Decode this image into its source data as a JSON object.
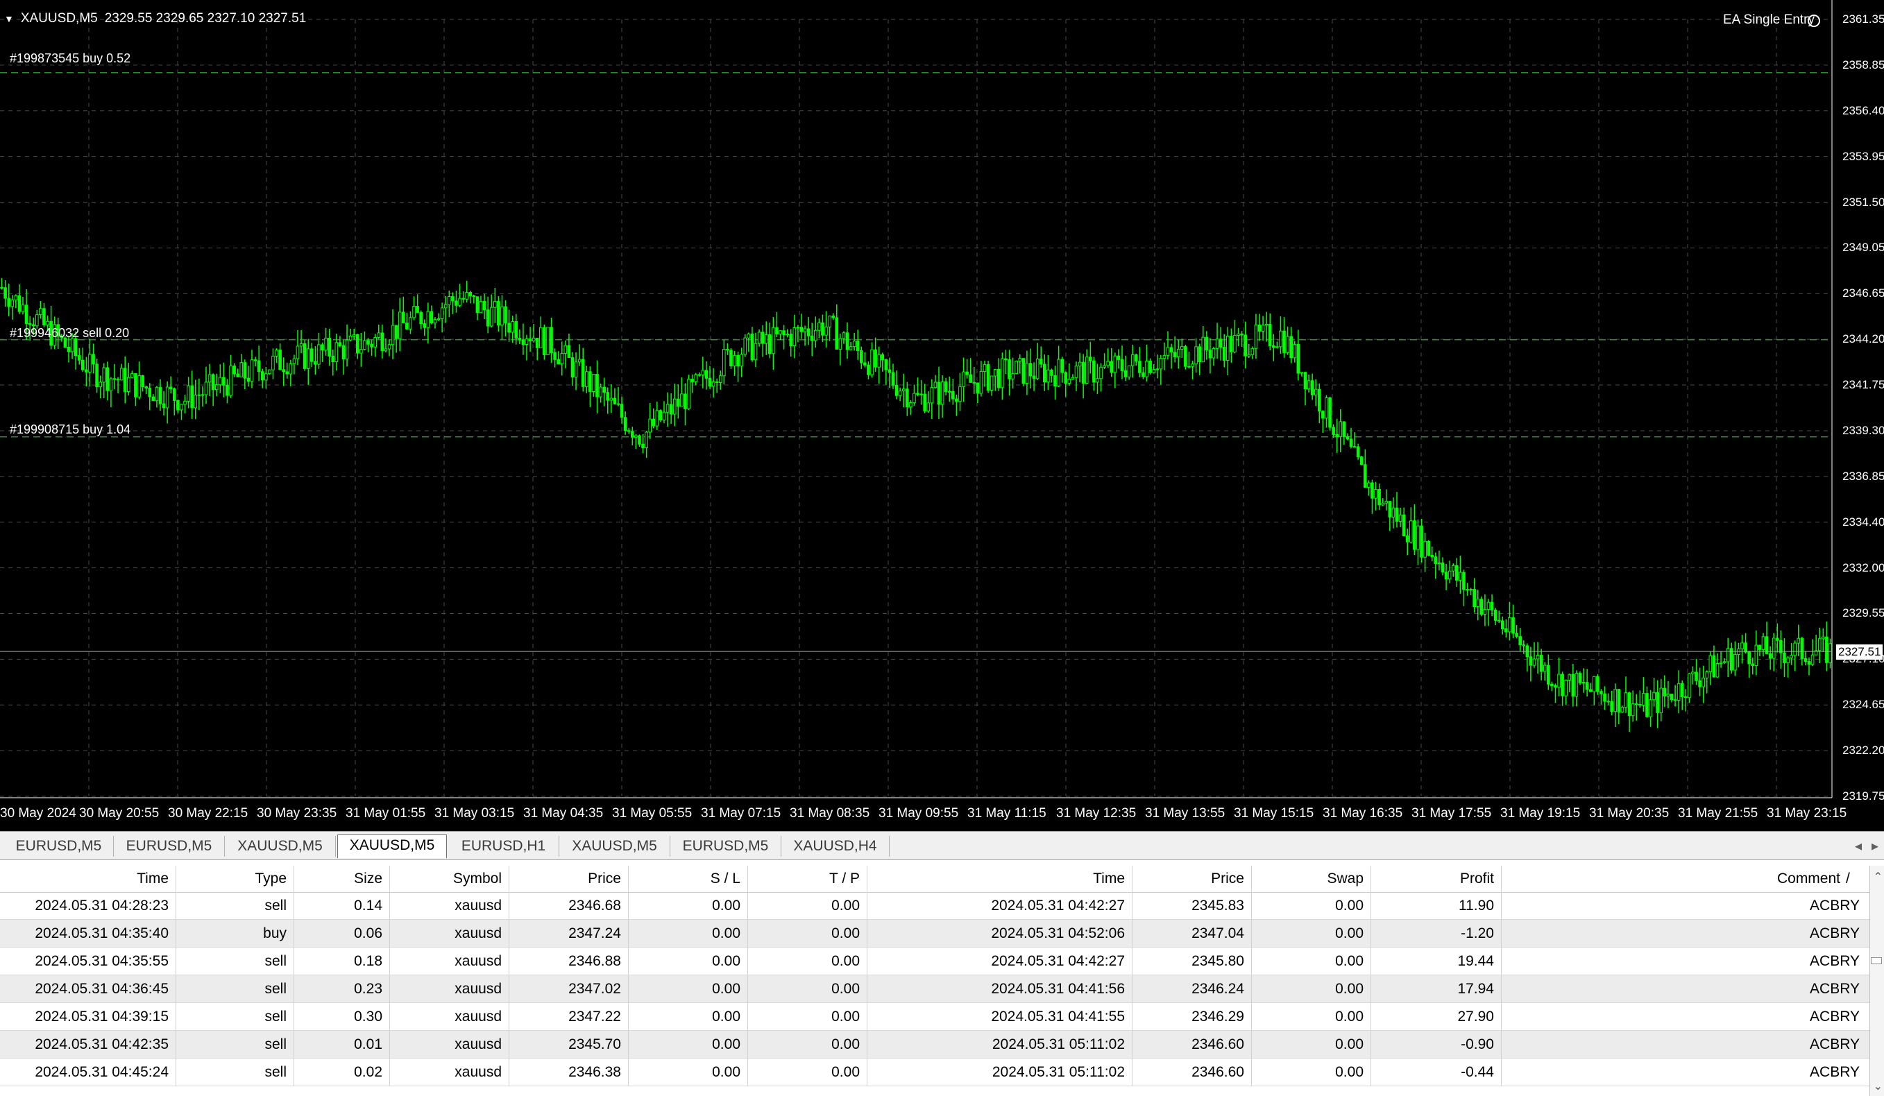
{
  "chart": {
    "header_symbol": "XAUUSD,M5",
    "header_prices": "2329.55 2329.65 2327.10 2327.51",
    "ea_label": "EA Single Entry",
    "current_price": "2327.51",
    "orders": [
      {
        "label": "#199873545 buy 0.52",
        "price": 2358.5
      },
      {
        "label": "#199946032 sell 0.20",
        "price": 2344.2
      },
      {
        "label": "#199908715 buy 1.04",
        "price": 2339.0
      }
    ],
    "price_axis": [
      "2361.35",
      "2358.85",
      "2356.40",
      "2353.95",
      "2351.50",
      "2349.05",
      "2346.65",
      "2344.20",
      "2341.75",
      "2339.30",
      "2336.85",
      "2334.40",
      "2332.00",
      "2329.55",
      "2327.10",
      "2324.65",
      "2322.20",
      "2319.75"
    ],
    "time_axis": [
      "30 May 2024",
      "30 May 20:55",
      "30 May 22:15",
      "30 May 23:35",
      "31 May 01:55",
      "31 May 03:15",
      "31 May 04:35",
      "31 May 05:55",
      "31 May 07:15",
      "31 May 08:35",
      "31 May 09:55",
      "31 May 11:15",
      "31 May 12:35",
      "31 May 13:55",
      "31 May 15:15",
      "31 May 16:35",
      "31 May 17:55",
      "31 May 19:15",
      "31 May 20:35",
      "31 May 21:55",
      "31 May 23:15"
    ],
    "colors": {
      "background": "#000000",
      "candle": "#00ff00",
      "grid": "#4a4a4a",
      "order_line": "#2e8b2e"
    }
  },
  "chart_data": {
    "type": "candlestick",
    "symbol": "XAUUSD",
    "timeframe": "M5",
    "ylim": [
      2319.75,
      2361.35
    ],
    "x": [
      "30 May 2024",
      "30 May 20:55",
      "30 May 22:15",
      "30 May 23:35",
      "31 May 01:55",
      "31 May 03:15",
      "31 May 04:35",
      "31 May 05:55",
      "31 May 07:15",
      "31 May 08:35",
      "31 May 09:55",
      "31 May 11:15",
      "31 May 12:35",
      "31 May 13:55",
      "31 May 15:15",
      "31 May 16:35",
      "31 May 17:55",
      "31 May 19:15",
      "31 May 20:35",
      "31 May 21:55",
      "31 May 23:15"
    ],
    "close_approx": [
      2347.0,
      2342.5,
      2341.0,
      2343.0,
      2344.0,
      2346.5,
      2344.0,
      2339.0,
      2343.5,
      2345.0,
      2341.0,
      2342.5,
      2342.5,
      2343.5,
      2344.5,
      2336.0,
      2331.0,
      2326.0,
      2324.5,
      2327.5,
      2327.51
    ],
    "grid": true
  },
  "tabs": [
    {
      "label": "EURUSD,M5",
      "active": false
    },
    {
      "label": "EURUSD,M5",
      "active": false
    },
    {
      "label": "XAUUSD,M5",
      "active": false
    },
    {
      "label": "XAUUSD,M5",
      "active": true
    },
    {
      "label": "EURUSD,H1",
      "active": false
    },
    {
      "label": "XAUUSD,M5",
      "active": false
    },
    {
      "label": "EURUSD,M5",
      "active": false
    },
    {
      "label": "XAUUSD,H4",
      "active": false
    }
  ],
  "table": {
    "columns": [
      "Time",
      "Type",
      "Size",
      "Symbol",
      "Price",
      "S / L",
      "T / P",
      "Time",
      "Price",
      "Swap",
      "Profit",
      "Comment"
    ],
    "sort_indicator": "/",
    "rows": [
      [
        "2024.05.31 04:28:23",
        "sell",
        "0.14",
        "xauusd",
        "2346.68",
        "0.00",
        "0.00",
        "2024.05.31 04:42:27",
        "2345.83",
        "0.00",
        "11.90",
        "ACBRY"
      ],
      [
        "2024.05.31 04:35:40",
        "buy",
        "0.06",
        "xauusd",
        "2347.24",
        "0.00",
        "0.00",
        "2024.05.31 04:52:06",
        "2347.04",
        "0.00",
        "-1.20",
        "ACBRY"
      ],
      [
        "2024.05.31 04:35:55",
        "sell",
        "0.18",
        "xauusd",
        "2346.88",
        "0.00",
        "0.00",
        "2024.05.31 04:42:27",
        "2345.80",
        "0.00",
        "19.44",
        "ACBRY"
      ],
      [
        "2024.05.31 04:36:45",
        "sell",
        "0.23",
        "xauusd",
        "2347.02",
        "0.00",
        "0.00",
        "2024.05.31 04:41:56",
        "2346.24",
        "0.00",
        "17.94",
        "ACBRY"
      ],
      [
        "2024.05.31 04:39:15",
        "sell",
        "0.30",
        "xauusd",
        "2347.22",
        "0.00",
        "0.00",
        "2024.05.31 04:41:55",
        "2346.29",
        "0.00",
        "27.90",
        "ACBRY"
      ],
      [
        "2024.05.31 04:42:35",
        "sell",
        "0.01",
        "xauusd",
        "2345.70",
        "0.00",
        "0.00",
        "2024.05.31 05:11:02",
        "2346.60",
        "0.00",
        "-0.90",
        "ACBRY"
      ],
      [
        "2024.05.31 04:45:24",
        "sell",
        "0.02",
        "xauusd",
        "2346.38",
        "0.00",
        "0.00",
        "2024.05.31 05:11:02",
        "2346.60",
        "0.00",
        "-0.44",
        "ACBRY"
      ]
    ]
  }
}
